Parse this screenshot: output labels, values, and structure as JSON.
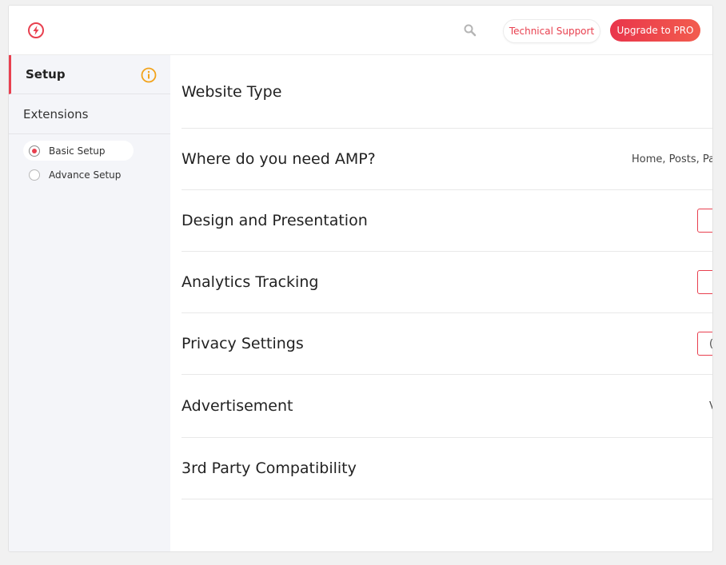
{
  "header": {
    "logo_icon": "lightning-bolt-icon",
    "search_icon": "search-icon",
    "support_label": "Technical Support",
    "upgrade_label": "Upgrade to PRO",
    "accent_color": "#e8404f"
  },
  "sidebar": {
    "setup_label": "Setup",
    "setup_icon": "info-icon",
    "extensions_label": "Extensions",
    "options": [
      {
        "label": "Basic Setup",
        "selected": true
      },
      {
        "label": "Advance Setup",
        "selected": false
      }
    ]
  },
  "main": {
    "rows": [
      {
        "title": "Website Type"
      },
      {
        "title": "Where do you need AMP?",
        "value": "Home, Posts, Pag"
      },
      {
        "title": "Design and Presentation"
      },
      {
        "title": "Analytics Tracking"
      },
      {
        "title": "Privacy Settings",
        "button_glyph": "("
      },
      {
        "title": "Advertisement",
        "value": "V"
      },
      {
        "title": "3rd Party Compatibility"
      }
    ]
  }
}
